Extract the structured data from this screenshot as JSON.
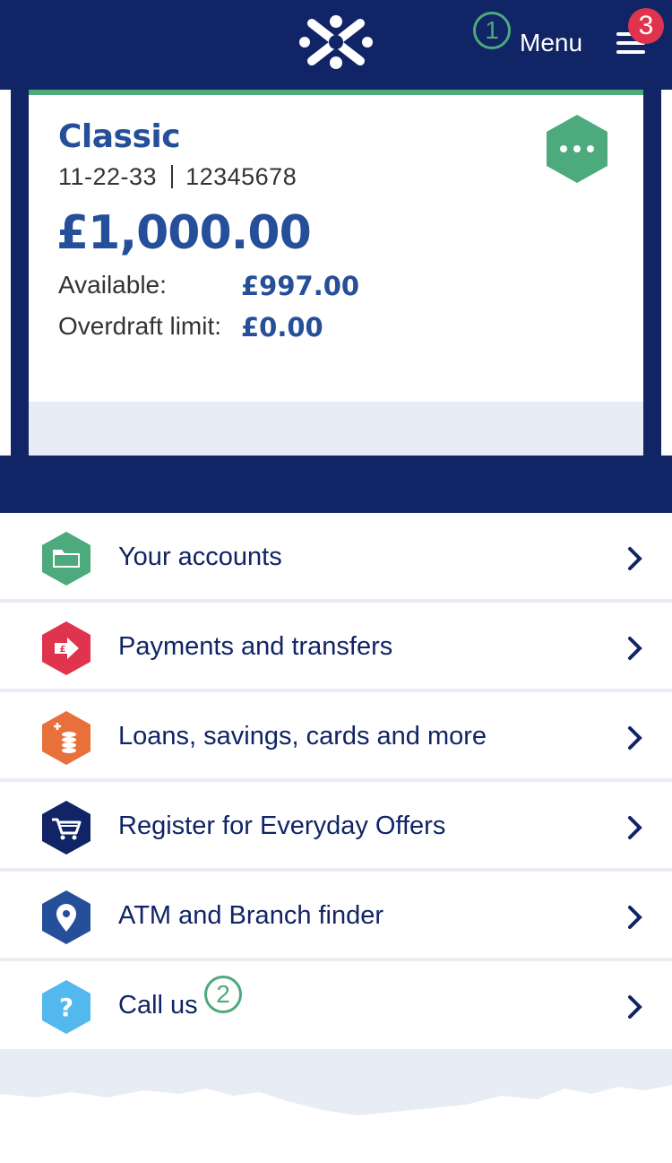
{
  "header": {
    "logo_icon": "bank-logo-icon",
    "menu_label": "Menu",
    "menu_icon": "hamburger-icon",
    "annotation_1": "1",
    "badge": "3"
  },
  "account": {
    "name": "Classic",
    "sort_code": "11-22-33",
    "account_number": "12345678",
    "balance": "£1,000.00",
    "available_label": "Available:",
    "available_value": "£997.00",
    "overdraft_label": "Overdraft limit:",
    "overdraft_value": "£0.00",
    "options_icon": "more-options-icon"
  },
  "menu": {
    "items": [
      {
        "label": "Your accounts",
        "icon": "folder-icon",
        "color": "#4caa7c"
      },
      {
        "label": "Payments and transfers",
        "icon": "pound-transfer-icon",
        "color": "#e0344e"
      },
      {
        "label": "Loans, savings, cards and more",
        "icon": "coins-icon",
        "color": "#e8703a"
      },
      {
        "label": "Register for Everyday Offers",
        "icon": "shopping-cart-icon",
        "color": "#102466"
      },
      {
        "label": "ATM and Branch finder",
        "icon": "location-pin-icon",
        "color": "#254f98"
      },
      {
        "label": "Call us",
        "icon": "question-icon",
        "color": "#52b8ee"
      }
    ],
    "annotation_2": "2"
  },
  "colors": {
    "navy": "#102466",
    "accent_green": "#4caa7c",
    "text_blue": "#254f98",
    "badge_red": "#e0344e",
    "light_grey": "#e8edf5"
  }
}
